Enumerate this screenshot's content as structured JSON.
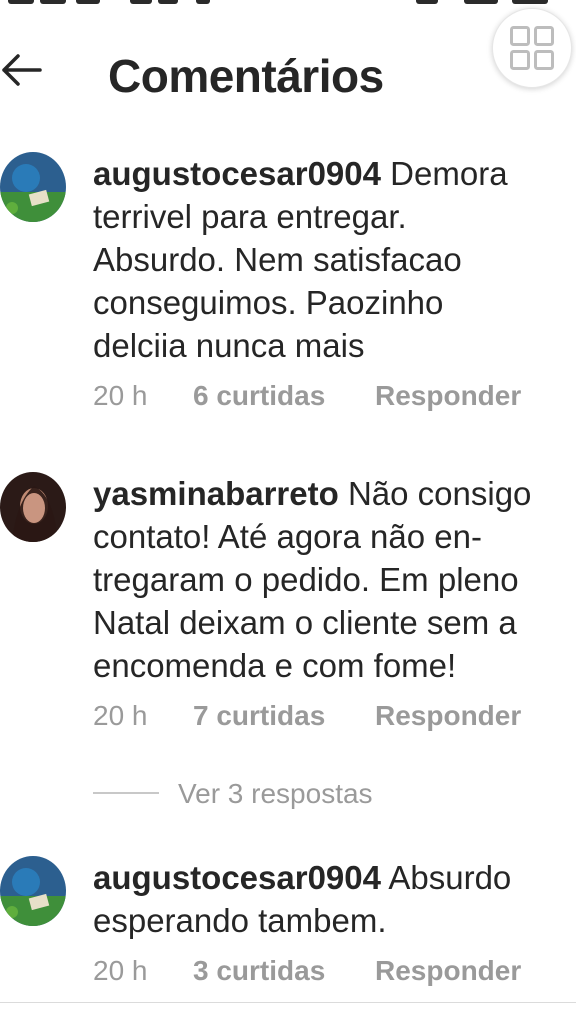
{
  "header": {
    "title": "Comentários",
    "back_icon": "arrow-left-icon",
    "grid_icon": "grid-icon"
  },
  "comments": [
    {
      "username": "augustocesar0904",
      "text_lines": [
        "Demora",
        "terrivel para  entregar.",
        "Absurdo. Nem satisfacao",
        "conseguimos. Paozinho",
        "delciia nunca mais"
      ],
      "time": "20 h",
      "likes": "6 curtidas",
      "reply": "Responder"
    },
    {
      "username": "yasminabarreto",
      "text_lines": [
        "Não consigo",
        "contato! Até agora não en-",
        "tregaram o pedido. Em pleno",
        "Natal deixam o cliente sem a",
        "encomenda e com fome!"
      ],
      "time": "20 h",
      "likes": "7 curtidas",
      "reply": "Responder",
      "view_replies": "Ver 3 respostas"
    },
    {
      "username": "augustocesar0904",
      "text_lines": [
        "Absurdo",
        "esperando tambem."
      ],
      "time": "20 h",
      "likes": "3 curtidas",
      "reply": "Responder"
    }
  ],
  "colors": {
    "text": "#262626",
    "secondary": "#9a9a9a"
  }
}
